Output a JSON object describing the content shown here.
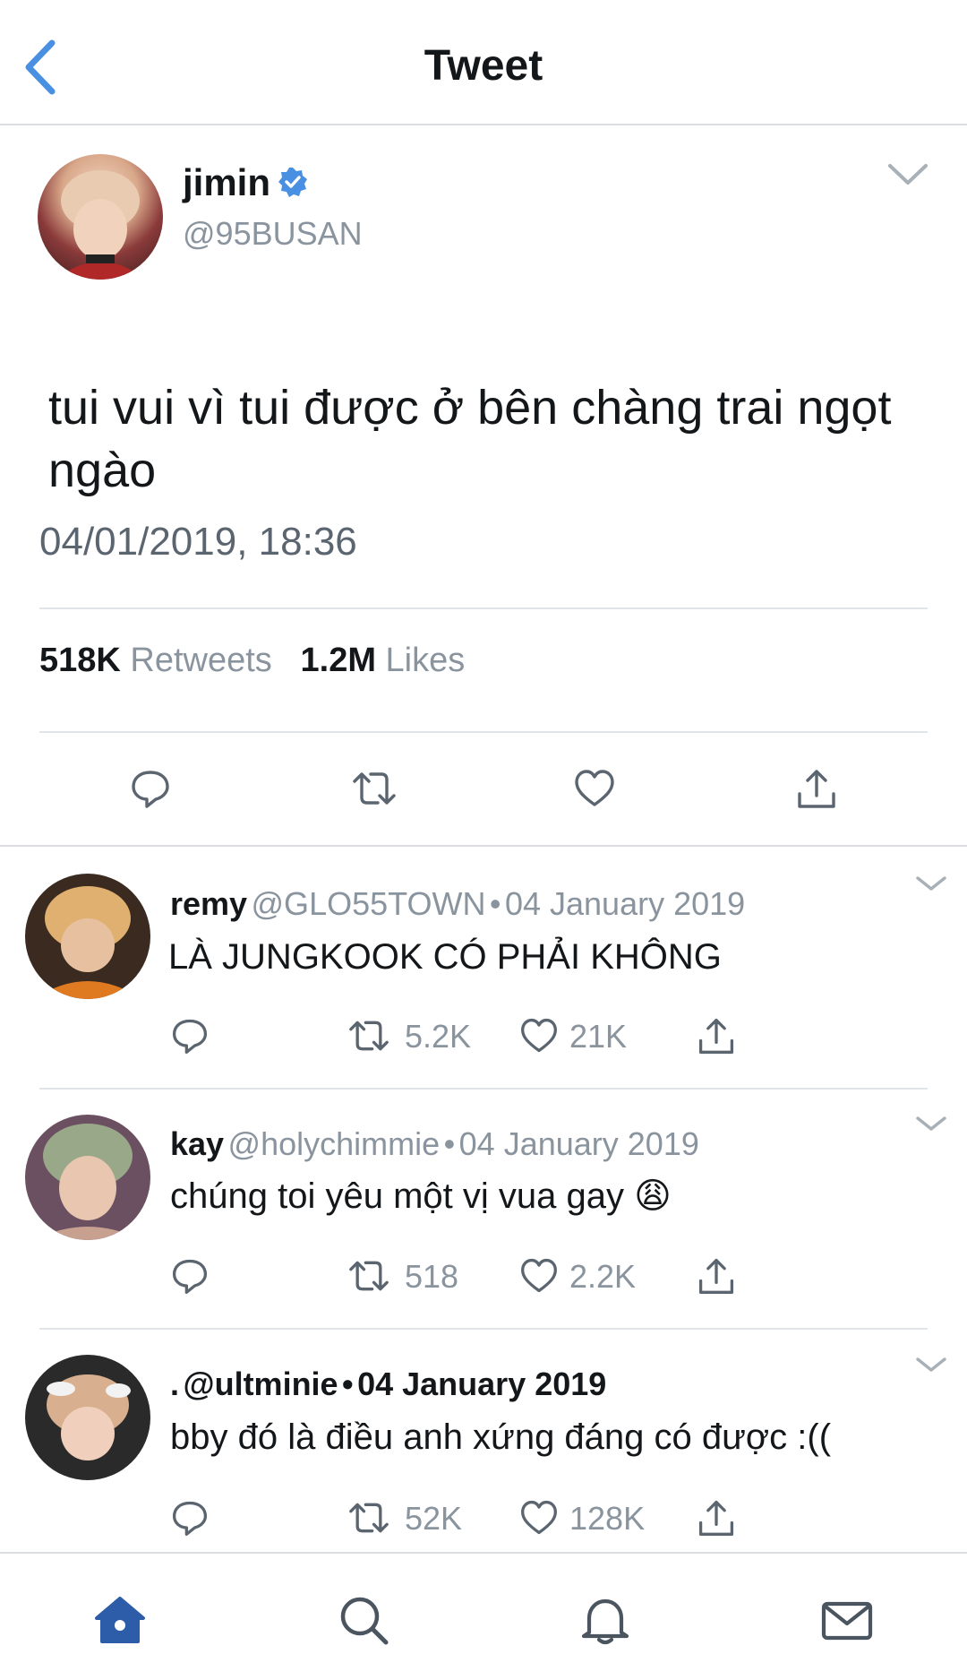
{
  "header": {
    "title": "Tweet",
    "back_icon": "back-chevron-icon"
  },
  "tweet": {
    "author_name": "jimin",
    "author_handle": "@95BUSAN",
    "verified": true,
    "text": "tui vui vì tui được ở bên chàng trai ngọt ngào",
    "timestamp": "04/01/2019, 18:36",
    "retweets": "518K",
    "retweets_label": "Retweets",
    "likes": "1.2M",
    "likes_label": "Likes"
  },
  "replies": [
    {
      "name": "remy",
      "handle": "@GLO55TOWN",
      "dot": "•",
      "date": "04 January 2019",
      "text": "LÀ JUNGKOOK CÓ PHẢI KHÔNG",
      "retweets": "5.2K",
      "likes": "21K"
    },
    {
      "name": "kay",
      "handle": "@holychimmie",
      "dot": "•",
      "date": "04 January 2019",
      "text": "chúng toi yêu một vị vua gay 😩",
      "retweets": "518",
      "likes": "2.2K"
    },
    {
      "name": ".",
      "handle": "@ultminie",
      "dot": "•",
      "date": "04 January 2019",
      "text": "bby đó là điều anh xứng đáng có được :((",
      "retweets": "52K",
      "likes": "128K"
    }
  ],
  "colors": {
    "accent": "#4a90e2",
    "nav_active": "#2d5da8",
    "text": "#14171a",
    "muted": "#8a949e"
  },
  "bottom_nav": [
    "home-icon",
    "search-icon",
    "notifications-bell-icon",
    "messages-envelope-icon"
  ]
}
